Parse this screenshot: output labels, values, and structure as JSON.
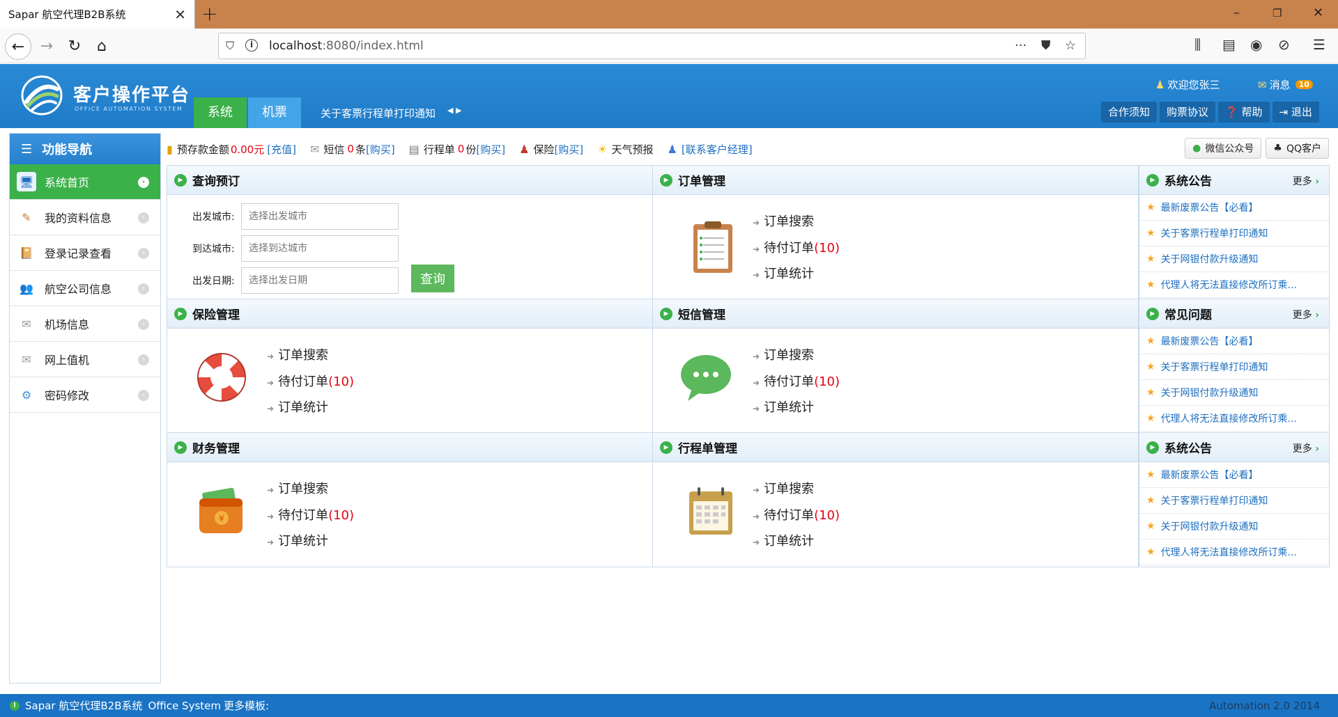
{
  "browser": {
    "tab_title": "Sapar 航空代理B2B系统",
    "tab_close": "✕",
    "new_tab": "+",
    "url_host": "localhost",
    "url_path": ":8080/index.html"
  },
  "header": {
    "logo_title": "客户操作平台",
    "logo_sub": "OFFICE AUTOMATION SYSTEM",
    "nav": [
      "系统",
      "机票"
    ],
    "marquee": "关于客票行程单打印通知",
    "welcome": "欢迎您张三",
    "msg_label": "消息",
    "msg_count": "10",
    "buttons": [
      "合作须知",
      "购票协议",
      "帮助",
      "退出"
    ]
  },
  "sidebar": {
    "title": "功能导航",
    "items": [
      {
        "label": "系统首页",
        "icon": "monitor-icon"
      },
      {
        "label": "我的资料信息",
        "icon": "edit-icon"
      },
      {
        "label": "登录记录查看",
        "icon": "book-icon"
      },
      {
        "label": "航空公司信息",
        "icon": "users-icon"
      },
      {
        "label": "机场信息",
        "icon": "mail-icon"
      },
      {
        "label": "网上值机",
        "icon": "mail-icon"
      },
      {
        "label": "密码修改",
        "icon": "gear-icon"
      }
    ]
  },
  "infobar": {
    "deposit_label": "预存款金额",
    "deposit_value": "0.00元",
    "deposit_link": "[充值]",
    "sms_label": "短信",
    "sms_count": "0",
    "sms_unit": "条",
    "sms_link": "[购买]",
    "itin_label": "行程单",
    "itin_count": "0",
    "itin_unit": "份",
    "itin_link": "[购买]",
    "ins_label": "保险",
    "ins_link": "[购买]",
    "weather": "天气预报",
    "manager_link": "[联系客户经理]",
    "wechat": "微信公众号",
    "qq": "QQ客户"
  },
  "query": {
    "title": "查询预订",
    "from_label": "出发城市:",
    "from_placeholder": "选择出发城市",
    "to_label": "到达城市:",
    "to_placeholder": "选择到达城市",
    "date_label": "出发日期:",
    "date_placeholder": "选择出发日期",
    "submit": "查询"
  },
  "panels": {
    "order": {
      "title": "订单管理"
    },
    "insurance": {
      "title": "保险管理"
    },
    "sms": {
      "title": "短信管理"
    },
    "finance": {
      "title": "财务管理"
    },
    "itinerary": {
      "title": "行程单管理"
    },
    "links": {
      "search": "订单搜索",
      "pending": "待付订单",
      "pending_count": "(10)",
      "stats": "订单统计"
    }
  },
  "news": {
    "more": "更多",
    "box1_title": "系统公告",
    "box2_title": "常见问题",
    "box3_title": "系统公告",
    "items": [
      "最新废票公告【必看】",
      "关于客票行程单打印通知",
      "关于网银付款升级通知",
      "代理人将无法直接修改所订乘..."
    ]
  },
  "footer": {
    "left": "Sapar 航空代理B2B系统",
    "office": "Office System",
    "more_label": "更多模板:",
    "right": "Automation 2.0 2014"
  }
}
